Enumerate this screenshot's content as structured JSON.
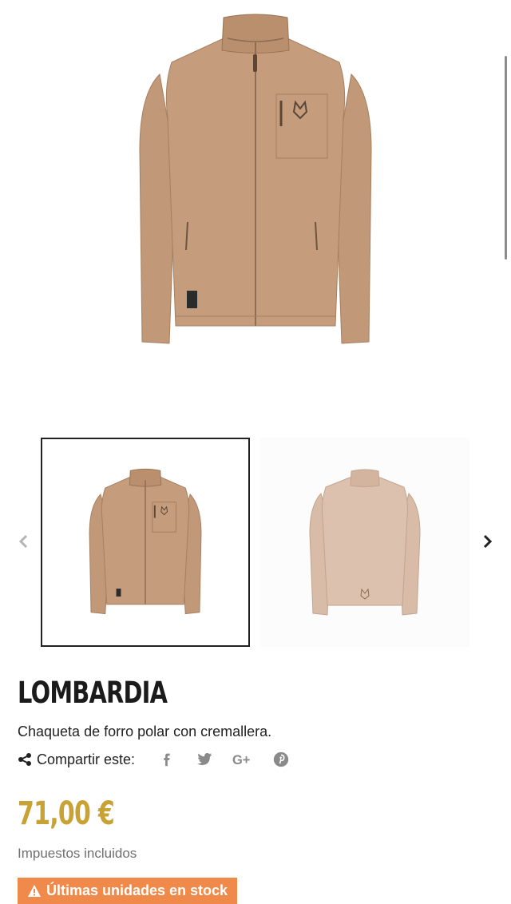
{
  "product": {
    "name": "LOMBARDIA",
    "description": "Chaqueta de forro polar con cremallera.",
    "share_label": "Compartir este:",
    "social": [
      "facebook-icon",
      "twitter-icon",
      "google-plus-icon",
      "pinterest-icon"
    ],
    "price": "71,00 €",
    "tax_note": "Impuestos incluidos",
    "stock_badge": "Últimas unidades en stock"
  },
  "gallery": {
    "thumbnails": [
      "front-view",
      "back-view"
    ],
    "selected_index": 0
  },
  "colors": {
    "jacket": "#c59d7c",
    "jacket_back": "#dcc1ae",
    "price": "#c9a236",
    "badge": "#f08a4b"
  }
}
